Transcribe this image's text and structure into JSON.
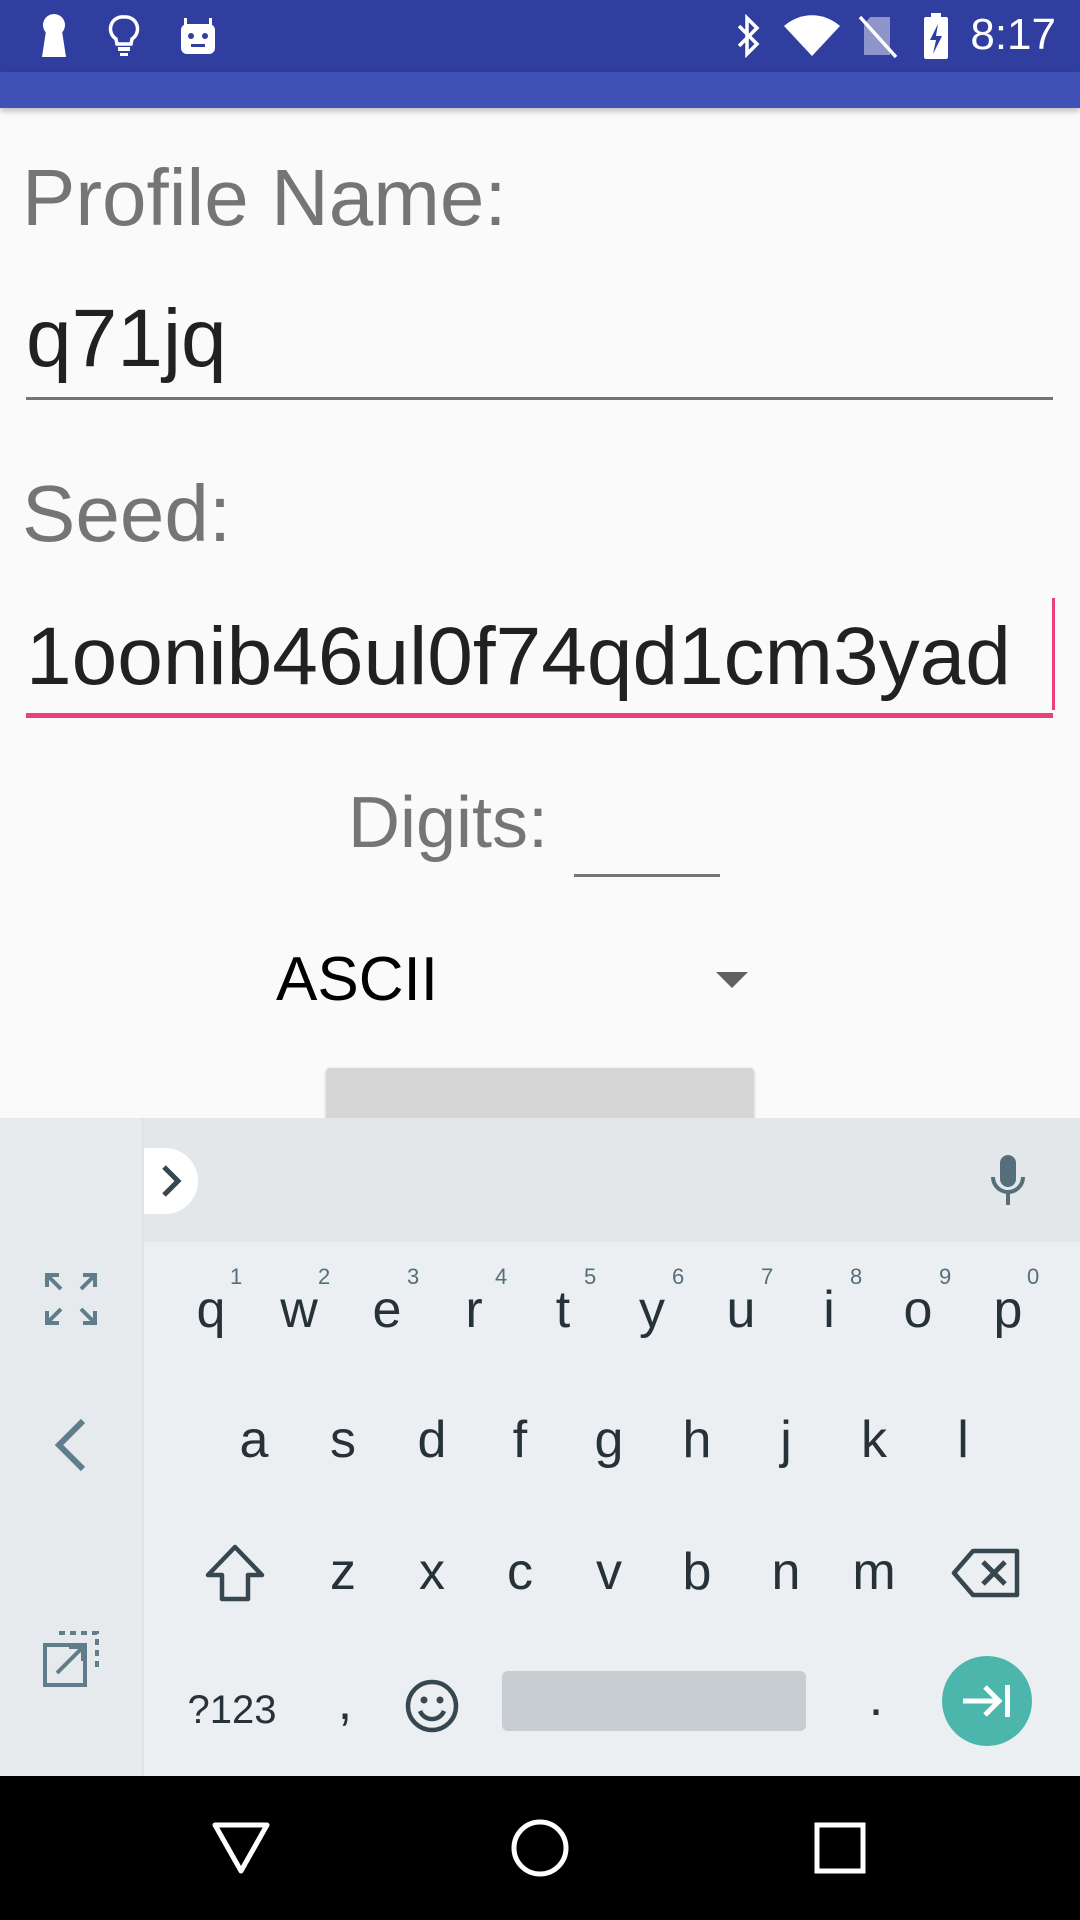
{
  "status_bar": {
    "time": "8:17",
    "left_icons": [
      "keyhole-icon",
      "lightbulb-icon",
      "android-icon"
    ],
    "right_icons": [
      "bluetooth-icon",
      "wifi-icon",
      "no-sim-icon",
      "battery-charging-icon"
    ]
  },
  "form": {
    "profile_label": "Profile Name:",
    "profile_value": "q71jq",
    "seed_label": "Seed:",
    "seed_value": "1oonib46ul0f74qd1cm3yad",
    "digits_label": "Digits:",
    "digits_value": "",
    "charset_selected": "ASCII"
  },
  "keyboard": {
    "row1": [
      "q",
      "w",
      "e",
      "r",
      "t",
      "y",
      "u",
      "i",
      "o",
      "p"
    ],
    "row1_hints": [
      "1",
      "2",
      "3",
      "4",
      "5",
      "6",
      "7",
      "8",
      "9",
      "0"
    ],
    "row2": [
      "a",
      "s",
      "d",
      "f",
      "g",
      "h",
      "j",
      "k",
      "l"
    ],
    "row3": [
      "z",
      "x",
      "c",
      "v",
      "b",
      "n",
      "m"
    ],
    "symbols_label": "?123",
    "comma": ",",
    "period": "."
  },
  "colors": {
    "status_bar": "#303f9f",
    "app_bar": "#3f51b5",
    "accent": "#ec407a",
    "enter_key": "#4db6ac"
  }
}
